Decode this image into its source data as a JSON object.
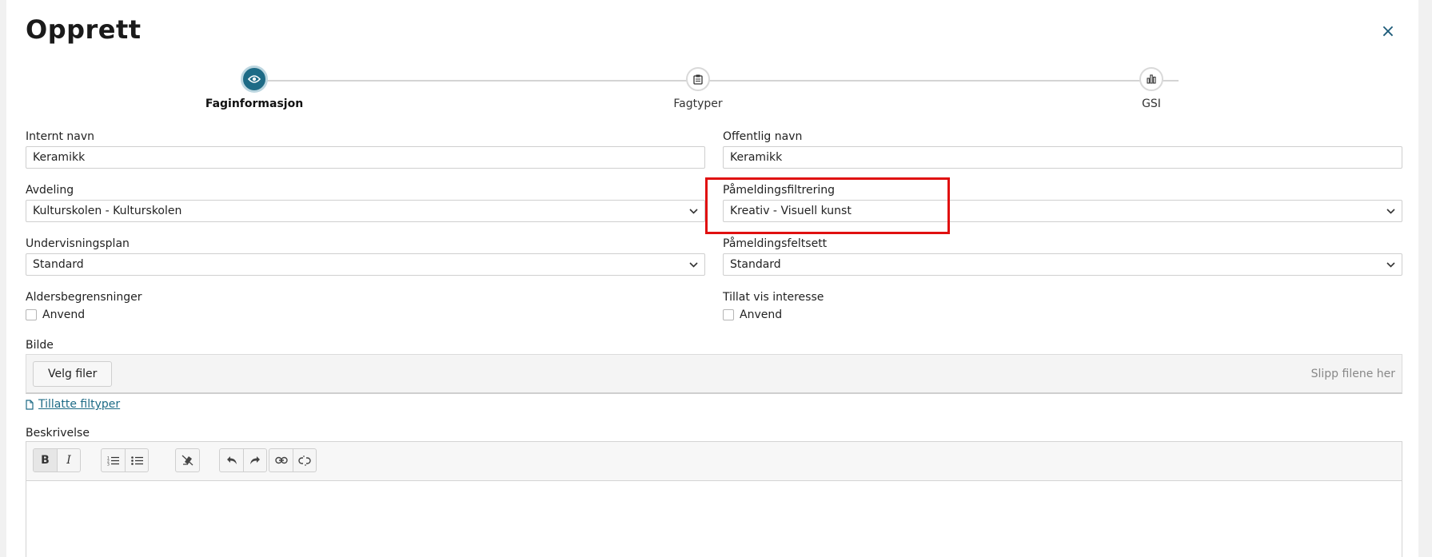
{
  "dialog": {
    "title": "Opprett",
    "close_label": "×"
  },
  "stepper": {
    "steps": [
      {
        "label": "Faginformasjon",
        "icon": "eye-icon",
        "active": true
      },
      {
        "label": "Fagtyper",
        "icon": "clipboard-icon",
        "active": false
      },
      {
        "label": "GSI",
        "icon": "bar-chart-icon",
        "active": false
      }
    ]
  },
  "form": {
    "internt_navn": {
      "label": "Internt navn",
      "value": "Keramikk"
    },
    "offentlig_navn": {
      "label": "Offentlig navn",
      "value": "Keramikk"
    },
    "avdeling": {
      "label": "Avdeling",
      "value": "Kulturskolen - Kulturskolen"
    },
    "pameldingsfiltrering": {
      "label": "Påmeldingsfiltrering",
      "value": "Kreativ - Visuell kunst"
    },
    "undervisningsplan": {
      "label": "Undervisningsplan",
      "value": "Standard"
    },
    "pameldingsfeltsett": {
      "label": "Påmeldingsfeltsett",
      "value": "Standard"
    },
    "aldersbegrensninger": {
      "label": "Aldersbegrensninger",
      "checkbox_label": "Anvend",
      "checked": false
    },
    "tillat_vis_interesse": {
      "label": "Tillat vis interesse",
      "checkbox_label": "Anvend",
      "checked": false
    },
    "bilde": {
      "label": "Bilde",
      "button_label": "Velg filer",
      "drop_hint": "Slipp filene her"
    },
    "tillatte_filtyper": "Tillatte filtyper",
    "beskrivelse": {
      "label": "Beskrivelse"
    }
  },
  "editor_toolbar": {
    "bold": "B",
    "italic": "I",
    "icons": [
      "ordered-list-icon",
      "bullet-list-icon",
      "clear-format-icon",
      "undo-icon",
      "redo-icon",
      "link-icon",
      "unlink-icon"
    ]
  },
  "colors": {
    "accent": "#1e6b86",
    "highlight": "#e01010"
  }
}
